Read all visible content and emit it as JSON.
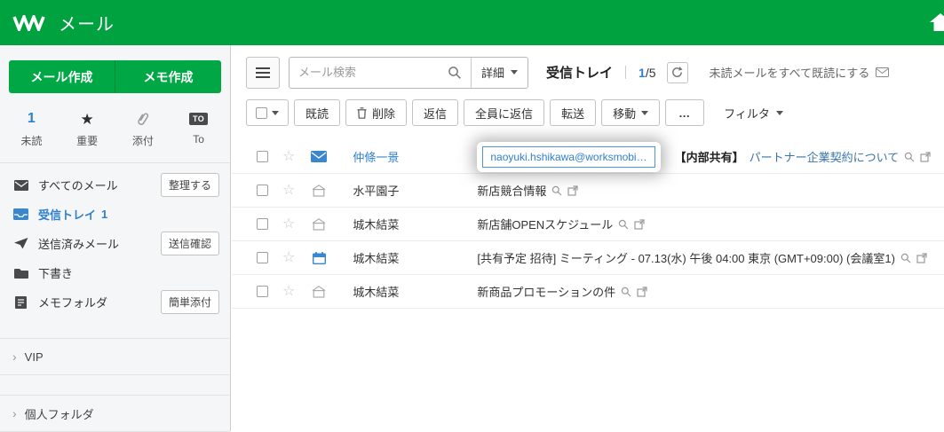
{
  "colors": {
    "brand_green": "#00a23f",
    "accent_blue": "#2f7fd0"
  },
  "icons": {
    "star_empty": "☆",
    "star_filled": "★",
    "chevron_right": "›"
  },
  "header": {
    "app_title": "メール"
  },
  "sidebar": {
    "compose_mail": "メール作成",
    "compose_memo": "メモ作成",
    "quick": {
      "unread_count": "1",
      "unread": "未読",
      "important": "重要",
      "attach": "添付",
      "to_badge": "TO",
      "to": "To"
    },
    "folders": {
      "all_mail": "すべてのメール",
      "organize": "整理する",
      "inbox": "受信トレイ",
      "inbox_count": "1",
      "sent": "送信済みメール",
      "send_confirm": "送信確認",
      "drafts": "下書き",
      "memo": "メモフォルダ",
      "easy_attach": "簡単添付"
    },
    "groups": {
      "vip": "VIP",
      "personal": "個人フォルダ"
    }
  },
  "toolbar": {
    "search_placeholder": "メール検索",
    "detail": "詳細",
    "folder_title": "受信トレイ",
    "page_current": "1",
    "page_sep": "/",
    "page_total": "5",
    "mark_all_read": "未読メールをすべて既読にする",
    "mark_read": "既読",
    "delete": "削除",
    "reply": "返信",
    "reply_all": "全員に返信",
    "forward": "転送",
    "move": "移動",
    "more": "…",
    "filter": "フィルタ"
  },
  "mail_list": {
    "rows": [
      {
        "sender": "仲條一景",
        "email_chip": "naoyuki.hshikawa@worksmobi…",
        "subject_prefix": "【内部共有】",
        "subject": "パートナー企業契約について"
      },
      {
        "sender": "水平園子",
        "subject": "新店競合情報"
      },
      {
        "sender": "城木結菜",
        "subject": "新店舗OPENスケジュール"
      },
      {
        "sender": "城木結菜",
        "subject": "[共有予定 招待] ミーティング - 07.13(水) 午後 04:00 東京 (GMT+09:00) (会議室1)"
      },
      {
        "sender": "城木結菜",
        "subject": "新商品プロモーションの件"
      }
    ]
  }
}
